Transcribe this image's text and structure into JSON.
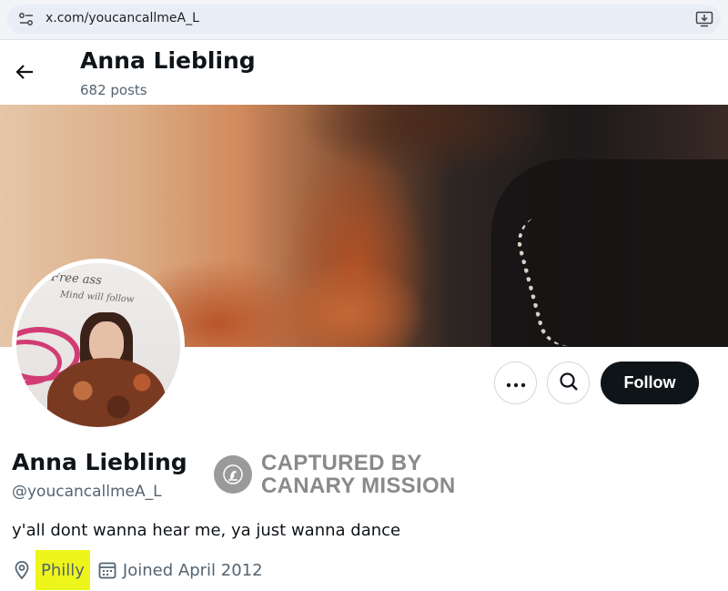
{
  "browser": {
    "url": "x.com/youcancallmeA_L"
  },
  "header": {
    "name": "Anna Liebling",
    "posts": "682 posts"
  },
  "avatar": {
    "graffiti_line_1": "Free ass",
    "graffiti_line_2": "Mind will follow"
  },
  "actions": {
    "more_icon": "more-horizontal-icon",
    "search_icon": "search-icon",
    "follow_label": "Follow"
  },
  "profile": {
    "name": "Anna Liebling",
    "handle": "@youcancallmeA_L",
    "bio": "y'all dont wanna hear me, ya just wanna dance",
    "location": "Philly",
    "joined": "Joined April 2012"
  },
  "watermark": {
    "line_1": "CAPTURED BY",
    "line_2": "CANARY MISSION"
  },
  "colors": {
    "follow_bg": "#0f1419",
    "secondary_text": "#536471",
    "highlight": "#eef51a",
    "watermark": "#8a8a8a"
  }
}
